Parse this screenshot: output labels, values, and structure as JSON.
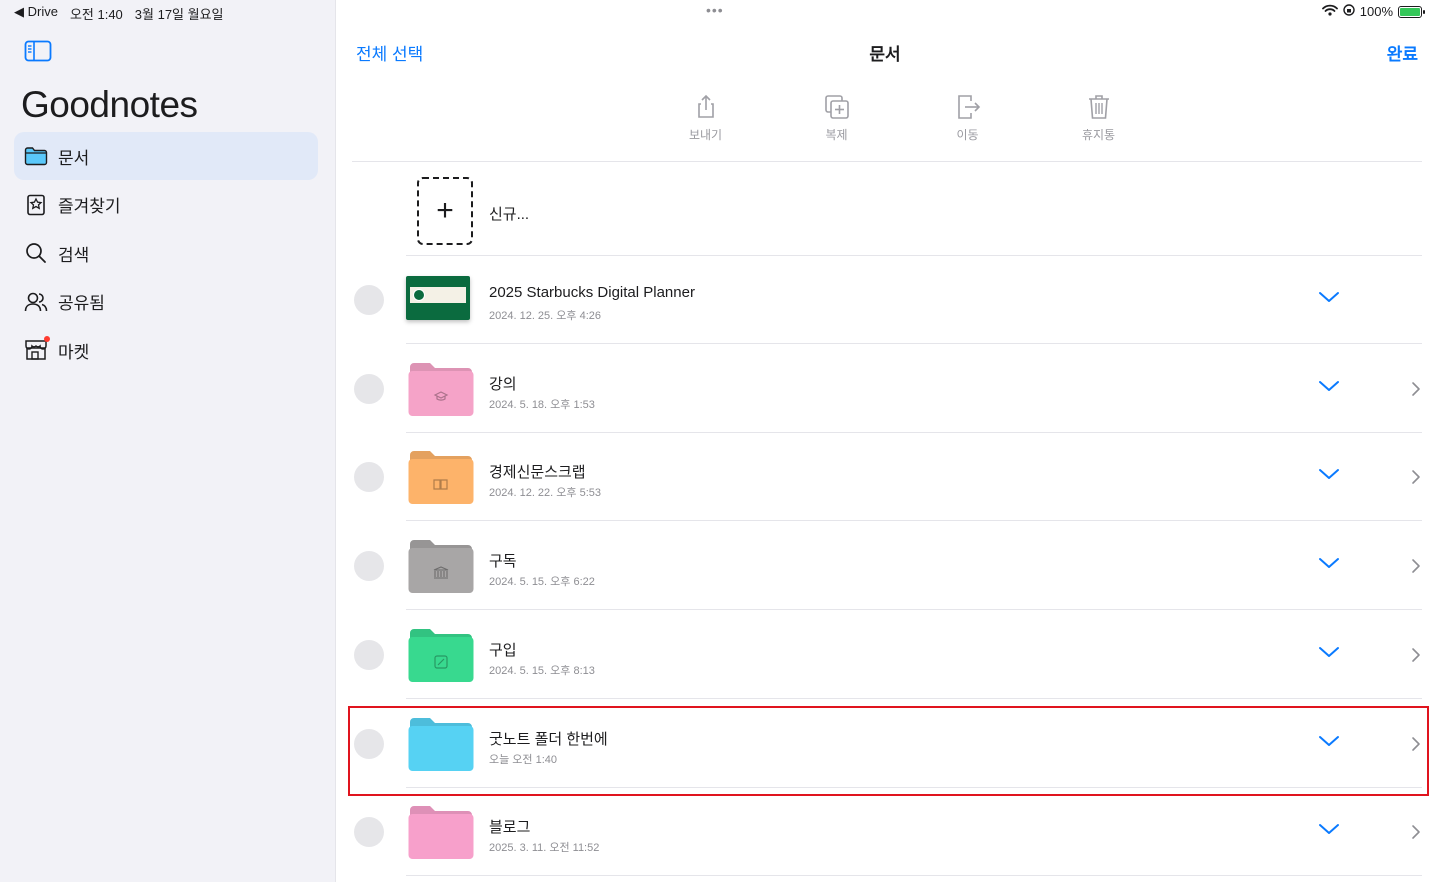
{
  "status": {
    "back_app": "◀ Drive",
    "time": "오전 1:40",
    "date": "3월 17일 월요일",
    "battery": "100%"
  },
  "sidebar": {
    "brand": "Goodnotes",
    "items": [
      {
        "label": "문서",
        "icon": "folder-icon"
      },
      {
        "label": "즐겨찾기",
        "icon": "bookmark-icon"
      },
      {
        "label": "검색",
        "icon": "search-icon"
      },
      {
        "label": "공유됨",
        "icon": "shared-people-icon"
      },
      {
        "label": "마켓",
        "icon": "store-icon"
      }
    ]
  },
  "header": {
    "select_all": "전체 선택",
    "title": "문서",
    "done": "완료"
  },
  "toolbar": {
    "send": "보내기",
    "duplicate": "복제",
    "move": "이동",
    "trash": "휴지통"
  },
  "new_item": {
    "plus": "+",
    "label": "신규..."
  },
  "rows": [
    {
      "name": "2025 Starbucks Digital Planner",
      "date": "2024. 12. 25. 오후 4:26",
      "kind": "notebook"
    },
    {
      "name": "강의",
      "date": "2024. 5. 18. 오후 1:53",
      "kind": "folder",
      "color": "#f5a3c8"
    },
    {
      "name": "경제신문스크랩",
      "date": "2024. 12. 22. 오후 5:53",
      "kind": "folder",
      "color": "#fdb36a"
    },
    {
      "name": "구독",
      "date": "2024. 5. 15. 오후 6:22",
      "kind": "folder",
      "color": "#a8a6a6"
    },
    {
      "name": "구입",
      "date": "2024. 5. 15. 오후 8:13",
      "kind": "folder",
      "color": "#38d98f"
    },
    {
      "name": "굿노트 폴더 한번에",
      "date": "오늘 오전 1:40",
      "kind": "folder",
      "color": "#56d2f3"
    },
    {
      "name": "블로그",
      "date": "2025. 3. 11. 오전 11:52",
      "kind": "folder",
      "color": "#f7a0cb"
    }
  ],
  "colors": {
    "accent": "#0a7aff",
    "highlight": "#e0141e"
  }
}
